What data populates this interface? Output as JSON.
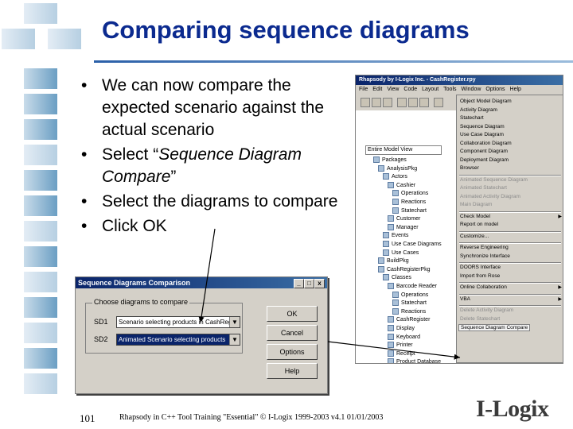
{
  "slide": {
    "title": "Comparing sequence diagrams",
    "bullets": [
      {
        "text": "We can now compare the expected scenario against the actual scenario"
      },
      {
        "prefix": "Select “",
        "italic": "Sequence Diagram Compare",
        "suffix": "”"
      },
      {
        "text": "Select the diagrams to compare"
      },
      {
        "text": "Click OK"
      }
    ],
    "page_number": "101",
    "footer_text": "Rhapsody in C++ Tool Training \"Essential\"  © I-Logix 1999-2003   v4.1  01/01/2003",
    "logo_text": "I-Logix"
  },
  "dialog": {
    "title": "Sequence Diagrams Comparison",
    "close_glyph": "x",
    "maximize_glyph": "□",
    "minimize_glyph": "_",
    "group_label": "Choose diagrams to compare",
    "sd1_label": "SD1",
    "sd1_value": "Scenario selecting products in CashReg",
    "sd2_label": "SD2",
    "sd2_value": "Animated Scenario selecting products",
    "combo_arrow": "▼",
    "ok_label": "OK",
    "cancel_label": "Cancel",
    "options_label": "Options",
    "help_label": "Help"
  },
  "app": {
    "title": "Rhapsody by I-Logix Inc. - CashRegister.rpy",
    "menu": [
      "File",
      "Edit",
      "View",
      "Code",
      "Layout",
      "Tools",
      "Window",
      "Options",
      "Help"
    ],
    "view_combo": "Entire Model View",
    "tree": [
      "Packages",
      "AnalysisPkg",
      "Actors",
      "Cashier",
      "Operations",
      "Reactions",
      "Statechart",
      "Customer",
      "Manager",
      "Events",
      "Use Case Diagrams",
      "Use Cases",
      "BuildPkg",
      "CashRegisterPkg",
      "Classes",
      "Barcode Reader",
      "Operations",
      "Statechart",
      "Reactions",
      "CashRegister",
      "Display",
      "Keyboard",
      "Printer",
      "Receipt",
      "Product Database"
    ],
    "tools_menu": [
      {
        "label": "Object Model Diagram",
        "state": "normal"
      },
      {
        "label": "Activity Diagram",
        "state": "normal"
      },
      {
        "label": "Statechart",
        "state": "normal"
      },
      {
        "label": "Sequence Diagram",
        "state": "normal"
      },
      {
        "label": "Use Case Diagram",
        "state": "normal"
      },
      {
        "label": "Collaboration Diagram",
        "state": "normal"
      },
      {
        "label": "Component Diagram",
        "state": "normal"
      },
      {
        "label": "Deployment Diagram",
        "state": "normal"
      },
      {
        "label": "Browser",
        "state": "normal"
      },
      {
        "label": "Animated Sequence Diagram",
        "state": "dim"
      },
      {
        "label": "Animated Statechart",
        "state": "dim"
      },
      {
        "label": "Animated Activity Diagram",
        "state": "dim"
      },
      {
        "label": "Main Diagram",
        "state": "dim"
      },
      {
        "label": "Check Model",
        "state": "submenu"
      },
      {
        "label": "Report on model",
        "state": "normal"
      },
      {
        "label": "Customize...",
        "state": "normal"
      },
      {
        "label": "Reverse Engineering",
        "state": "normal"
      },
      {
        "label": "Synchronize Interface",
        "state": "normal"
      },
      {
        "label": "DOORS Interface",
        "state": "normal"
      },
      {
        "label": "Import from Rose",
        "state": "normal"
      },
      {
        "label": "Online Collaboration",
        "state": "submenu"
      },
      {
        "label": "VBA",
        "state": "submenu"
      },
      {
        "label": "Delete Activity Diagram",
        "state": "dim"
      },
      {
        "label": "Delete Statechart",
        "state": "dim"
      },
      {
        "label": "Sequence Diagram Compare",
        "state": "highlight"
      }
    ]
  }
}
